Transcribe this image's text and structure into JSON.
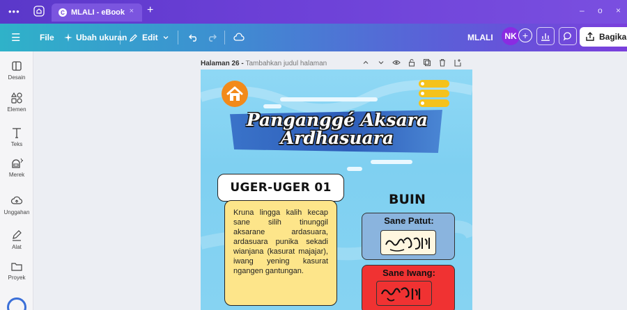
{
  "browser": {
    "tab_title": "MLALI - eBook",
    "tab_close": "×",
    "new_tab": "+",
    "menu_dots": "•••",
    "minimize": "–",
    "maximize": "o",
    "close": "×"
  },
  "toolbar": {
    "menu_icon": "☰",
    "file": "File",
    "resize": "Ubah ukuran",
    "edit": "Edit",
    "project_name": "MLALI",
    "avatar_initials": "NK",
    "add_member": "+",
    "share": "Bagikan"
  },
  "sidebar": {
    "items": [
      {
        "label": "Desain",
        "icon": "layout-icon"
      },
      {
        "label": "Elemen",
        "icon": "shapes-icon"
      },
      {
        "label": "Teks",
        "icon": "text-icon"
      },
      {
        "label": "Merek",
        "icon": "brand-icon"
      },
      {
        "label": "Unggahan",
        "icon": "cloud-upload-icon"
      },
      {
        "label": "Alat",
        "icon": "pen-icon"
      },
      {
        "label": "Proyek",
        "icon": "folder-icon"
      }
    ]
  },
  "page_header": {
    "page_label": "Halaman 26 - ",
    "page_title_placeholder": "Tambahkan judul halaman"
  },
  "design": {
    "title": "Pangangge Aksara Ardhasuara",
    "title_line1": "Panganggé Aksara",
    "title_line2": "Ardhasuara",
    "rule_heading": "UGER-UGER 01",
    "rule_body": "Kruna lingga kalih kecap sane silih tinunggil aksarane ardasuara, ardasuara punika sekadi wianjana (kasurat majajar), iwang yening kasurat ngangen gantungan.",
    "example_heading": "BUIN",
    "correct_label": "Sane Patut:",
    "wrong_label": "Sane Iwang:"
  },
  "colors": {
    "accent_purple": "#6b3fd6",
    "page_bg": "#8fd8f5",
    "banner_blue": "#2d5cb8",
    "rule_box_yellow": "#fde58a",
    "correct_box_blue": "#8ab4de",
    "wrong_box_red": "#f03232",
    "home_badge_orange": "#f28a1a"
  }
}
